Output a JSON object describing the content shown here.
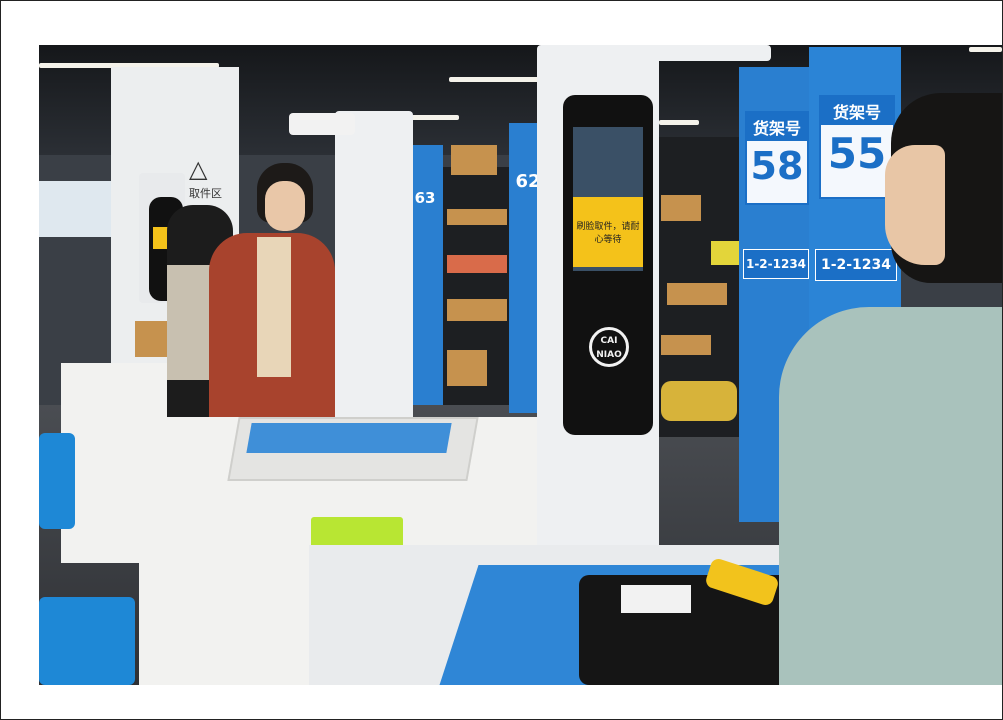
{
  "scene": {
    "shelf_label": "货架号",
    "shelf_numbers": [
      "58",
      "55",
      "62",
      "63"
    ],
    "shelf_codes": [
      "1-2-1234",
      "1-2-1234"
    ],
    "kiosk_message": "刷脸取件，请耐心等待",
    "kiosk_logo": "CAI NIAO",
    "zone_sign": "取件区",
    "colors": {
      "brand_blue": "#1b6fc6",
      "screen_yellow": "#f4c21a",
      "basket_green": "#b8e633"
    }
  }
}
